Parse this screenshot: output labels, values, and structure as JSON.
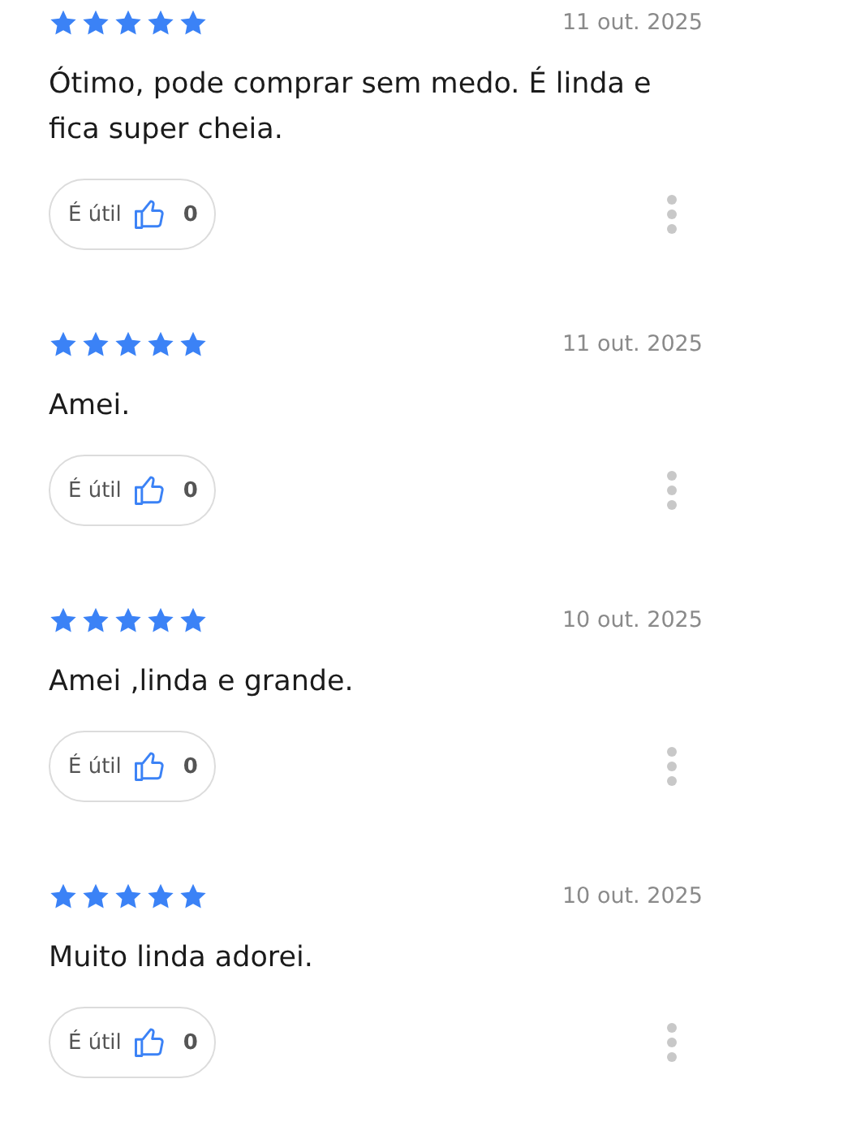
{
  "reviews": [
    {
      "stars": 5,
      "date": "11 out. 2025",
      "text": "Ótimo, pode comprar sem medo. É linda e fica super cheia.",
      "helpful_label": "É útil",
      "helpful_count": "0"
    },
    {
      "stars": 5,
      "date": "11 out. 2025",
      "text": "Amei.",
      "helpful_label": "É útil",
      "helpful_count": "0"
    },
    {
      "stars": 5,
      "date": "10 out. 2025",
      "text": "Amei ,linda e grande.",
      "helpful_label": "É útil",
      "helpful_count": "0"
    },
    {
      "stars": 5,
      "date": "10 out. 2025",
      "text": "Muito linda adorei.",
      "helpful_label": "É útil",
      "helpful_count": "0"
    }
  ]
}
